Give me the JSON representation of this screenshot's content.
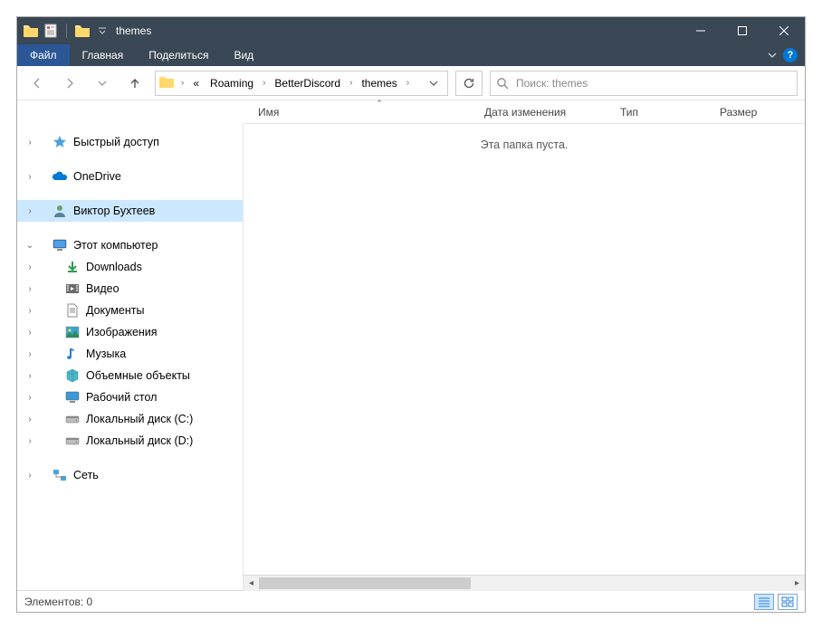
{
  "title": "themes",
  "ribbon": {
    "file": "Файл",
    "home": "Главная",
    "share": "Поделиться",
    "view": "Вид"
  },
  "breadcrumbs": {
    "prefix": "«",
    "items": [
      "Roaming",
      "BetterDiscord",
      "themes"
    ]
  },
  "search": {
    "placeholder": "Поиск: themes"
  },
  "columns": {
    "name": "Имя",
    "date": "Дата изменения",
    "type": "Тип",
    "size": "Размер"
  },
  "empty_text": "Эта папка пуста.",
  "nav": {
    "quick_access": "Быстрый доступ",
    "onedrive": "OneDrive",
    "user": "Виктор Бухтеев",
    "this_pc": "Этот компьютер",
    "downloads": "Downloads",
    "videos": "Видео",
    "documents": "Документы",
    "pictures": "Изображения",
    "music": "Музыка",
    "objects3d": "Объемные объекты",
    "desktop": "Рабочий стол",
    "disk_c": "Локальный диск (C:)",
    "disk_d": "Локальный диск (D:)",
    "network": "Сеть"
  },
  "status": {
    "items": "Элементов: 0"
  }
}
